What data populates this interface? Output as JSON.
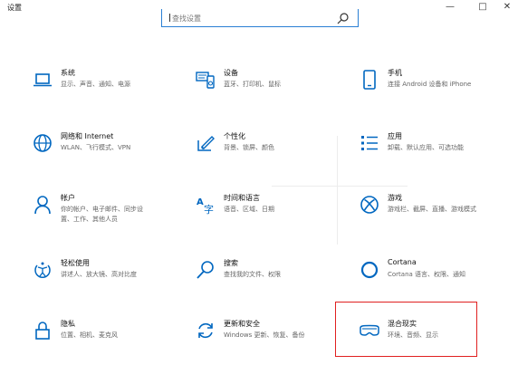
{
  "window": {
    "title": "设置",
    "minimize": "—",
    "maximize": "□",
    "close": "✕"
  },
  "search": {
    "placeholder": "查找设置"
  },
  "tiles": [
    {
      "title": "系统",
      "desc": "显示、声音、通知、电源",
      "icon": "laptop-icon"
    },
    {
      "title": "设备",
      "desc": "蓝牙、打印机、鼠标",
      "icon": "devices-icon"
    },
    {
      "title": "手机",
      "desc": "连接 Android 设备和 iPhone",
      "icon": "phone-icon"
    },
    {
      "title": "网络和 Internet",
      "desc": "WLAN、飞行模式、VPN",
      "icon": "globe-icon"
    },
    {
      "title": "个性化",
      "desc": "背景、锁屏、颜色",
      "icon": "personalization-icon"
    },
    {
      "title": "应用",
      "desc": "卸载、默认应用、可选功能",
      "icon": "apps-icon"
    },
    {
      "title": "帐户",
      "desc1": "你的帐户、电子邮件、同步设",
      "desc2": "置、工作、其他人员",
      "icon": "person-icon"
    },
    {
      "title": "时间和语言",
      "desc": "语音、区域、日期",
      "icon": "time-language-icon"
    },
    {
      "title": "游戏",
      "desc": "游戏栏、截屏、直播、游戏模式",
      "icon": "xbox-icon"
    },
    {
      "title": "轻松使用",
      "desc": "讲述人、放大镜、高对比度",
      "icon": "ease-of-access-icon"
    },
    {
      "title": "搜索",
      "desc": "查找我的文件、权限",
      "icon": "search-icon"
    },
    {
      "title": "Cortana",
      "desc": "Cortana 语言、权限、通知",
      "icon": "cortana-icon"
    },
    {
      "title": "隐私",
      "desc": "位置、相机、麦克风",
      "icon": "lock-icon"
    },
    {
      "title": "更新和安全",
      "desc": "Windows 更新、恢复、备份",
      "icon": "update-icon"
    },
    {
      "title": "混合现实",
      "desc": "环境、音频、显示",
      "icon": "mixed-reality-icon"
    }
  ],
  "colors": {
    "accent": "#0067c0",
    "highlight": "#e02020"
  }
}
